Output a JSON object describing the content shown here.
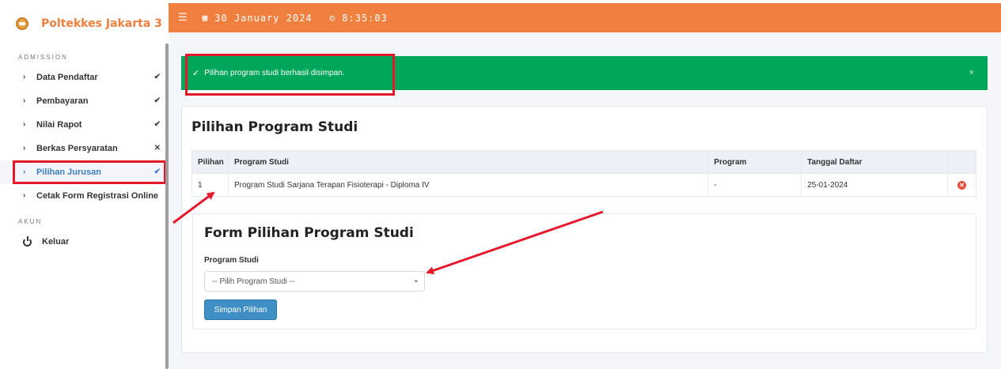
{
  "brand": {
    "name": "Poltekkes Jakarta 3"
  },
  "header": {
    "date": "30 January 2024",
    "time": "8:35:03",
    "menu_icon": "hamburger-icon",
    "date_icon": "calendar-icon",
    "time_icon": "clock-icon"
  },
  "sidebar": {
    "section_admission": "ADMISSION",
    "items": [
      {
        "label": "Data Pendaftar",
        "status": "✔"
      },
      {
        "label": "Pembayaran",
        "status": "✔"
      },
      {
        "label": "Nilai Rapot",
        "status": "✔"
      },
      {
        "label": "Berkas Persyaratan",
        "status": "✕"
      },
      {
        "label": "Pilihan Jurusan",
        "status": "✔"
      },
      {
        "label": "Cetak Form Registrasi Online",
        "status": ""
      }
    ],
    "section_akun": "AKUN",
    "logout_label": "Keluar"
  },
  "alert": {
    "message": "Pilihan program studi berhasil disimpan.",
    "close": "×",
    "color": "#00a65a"
  },
  "card": {
    "title": "Pilihan Program Studi",
    "columns": [
      "Pilihan",
      "Program Studi",
      "Program",
      "Tanggal Daftar",
      ""
    ],
    "rows": [
      {
        "pilihan": "1",
        "program_studi": "Program Studi Sarjana Terapan Fisioterapi - Diploma IV",
        "program": "-",
        "tanggal": "25-01-2024",
        "remove": "✕"
      }
    ]
  },
  "form": {
    "title": "Form Pilihan Program Studi",
    "field_label": "Program Studi",
    "select_value": "-- Pilih Program Studi --",
    "submit_label": "Simpan Pilihan"
  },
  "colors": {
    "header": "#ef8040",
    "brand": "#ef7f3c",
    "accent": "#3b7ec2",
    "button": "#3f8fc4",
    "annotation": "#e3182a"
  }
}
